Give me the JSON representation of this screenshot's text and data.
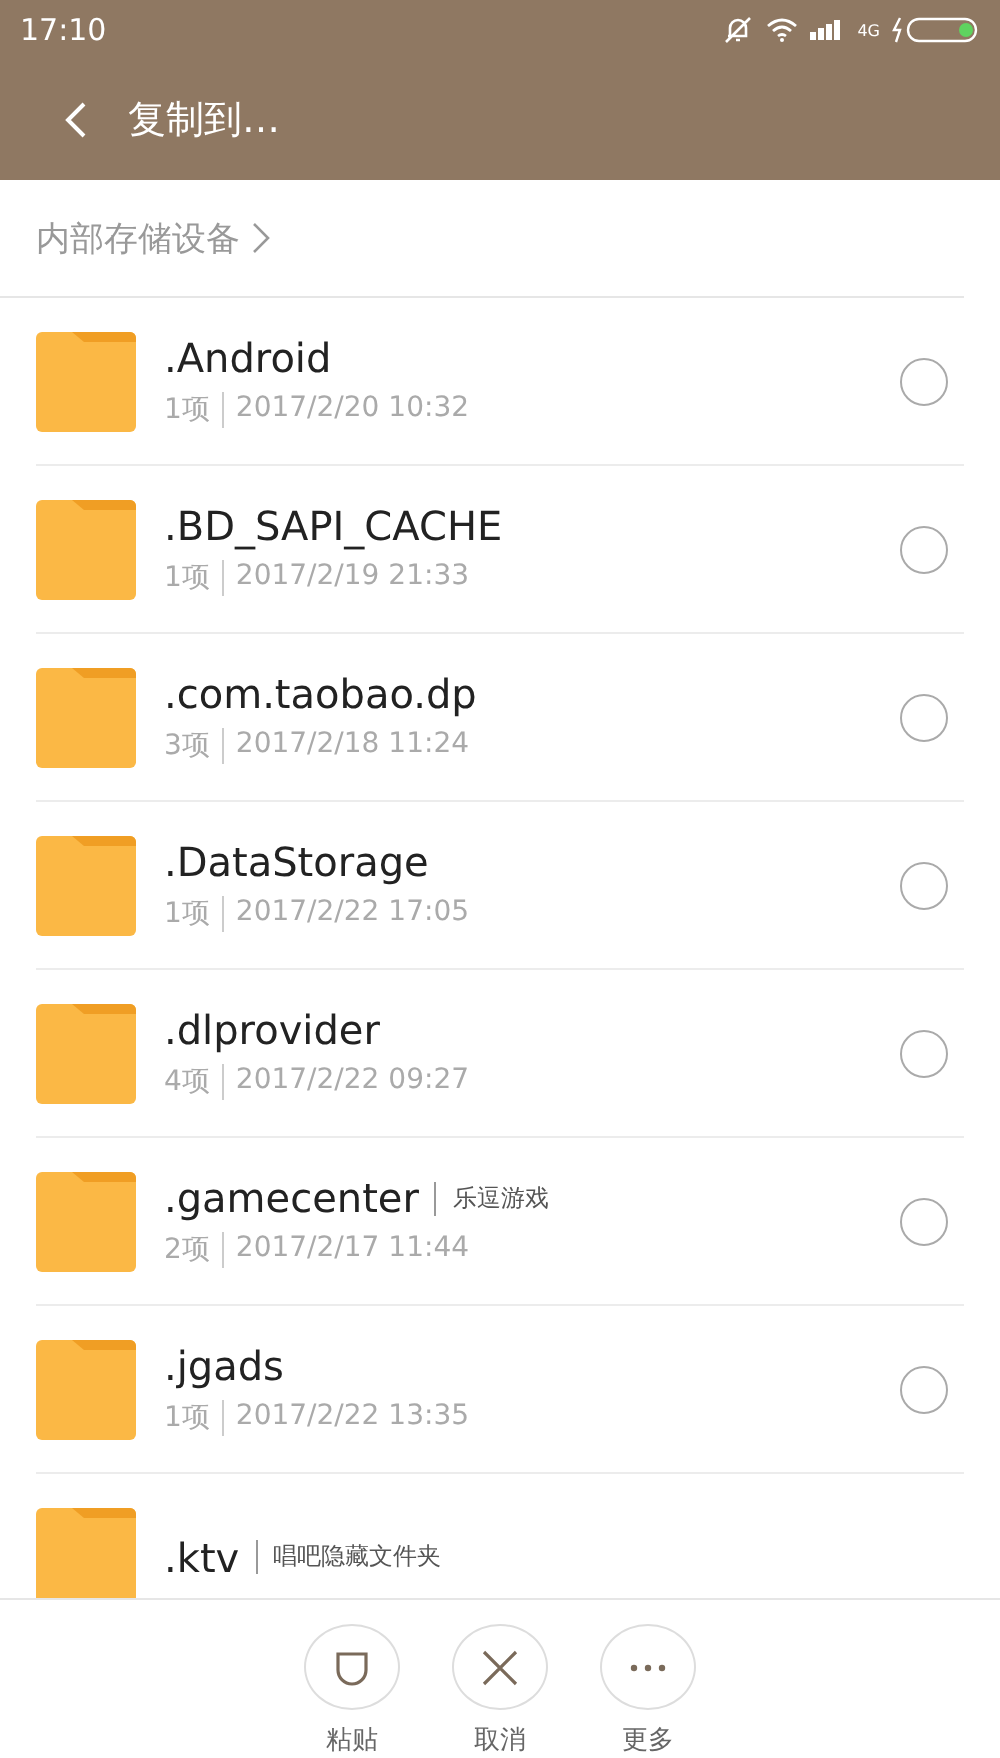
{
  "status_bar": {
    "time": "17:10",
    "network": "4G"
  },
  "toolbar": {
    "title": "复制到…"
  },
  "breadcrumb": {
    "label": "内部存储设备"
  },
  "folders": [
    {
      "name": ".Android",
      "count": "1项",
      "date": "2017/2/20 10:32",
      "selected": false
    },
    {
      "name": ".BD_SAPI_CACHE",
      "count": "1项",
      "date": "2017/2/19 21:33",
      "selected": false
    },
    {
      "name": ".com.taobao.dp",
      "count": "3项",
      "date": "2017/2/18 11:24",
      "selected": false
    },
    {
      "name": ".DataStorage",
      "count": "1项",
      "date": "2017/2/22 17:05",
      "selected": false
    },
    {
      "name": ".dlprovider",
      "count": "4项",
      "date": "2017/2/22 09:27",
      "selected": false
    },
    {
      "name": ".gamecenter",
      "tag": "乐逗游戏",
      "count": "2项",
      "date": "2017/2/17 11:44",
      "selected": false
    },
    {
      "name": ".jgads",
      "count": "1项",
      "date": "2017/2/22 13:35",
      "selected": false
    },
    {
      "name": ".ktv",
      "tag": "唱吧隐藏文件夹"
    }
  ],
  "actions": [
    {
      "kind": "paste",
      "label": "粘贴"
    },
    {
      "kind": "cancel",
      "label": "取消"
    },
    {
      "kind": "more",
      "label": "更多"
    }
  ]
}
